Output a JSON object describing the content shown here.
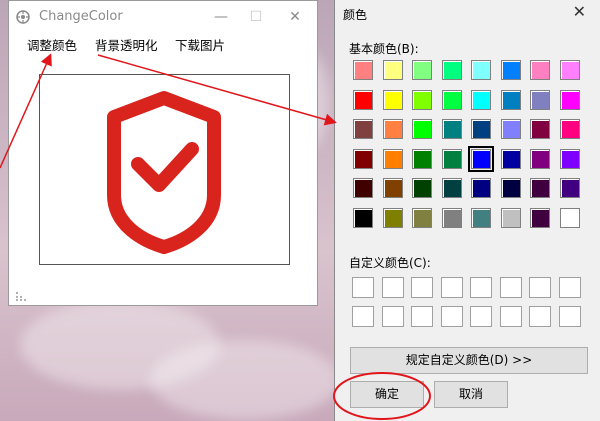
{
  "app": {
    "title": "ChangeColor",
    "menu": [
      "调整颜色",
      "背景透明化",
      "下载图片"
    ],
    "controls": {
      "minimize": "—",
      "maximize": "☐",
      "close": "✕"
    },
    "shield_color": "#d9241d"
  },
  "dialog": {
    "title": "颜色",
    "close": "✕",
    "basic_label": "基本颜色(B):",
    "custom_label": "自定义颜色(C):",
    "define_button": "规定自定义颜色(D) >>",
    "ok_button": "确定",
    "cancel_button": "取消",
    "selected_swatch": "row4-col5",
    "basic_colors": [
      [
        "#ff8080",
        "#ffff80",
        "#80ff80",
        "#00ff80",
        "#80ffff",
        "#0080ff",
        "#ff80c0",
        "#ff80ff"
      ],
      [
        "#ff0000",
        "#ffff00",
        "#80ff00",
        "#00ff40",
        "#00ffff",
        "#0080c0",
        "#8080c0",
        "#ff00ff"
      ],
      [
        "#804040",
        "#ff8040",
        "#00ff00",
        "#008080",
        "#004080",
        "#8080ff",
        "#800040",
        "#ff0080"
      ],
      [
        "#800000",
        "#ff8000",
        "#008000",
        "#008040",
        "#0000ff",
        "#0000a0",
        "#800080",
        "#8000ff"
      ],
      [
        "#400000",
        "#804000",
        "#004000",
        "#004040",
        "#000080",
        "#000040",
        "#400040",
        "#400080"
      ],
      [
        "#000000",
        "#808000",
        "#808040",
        "#808080",
        "#408080",
        "#c0c0c0",
        "#400040",
        "#ffffff"
      ]
    ]
  },
  "annotation_color": "#e0161b"
}
